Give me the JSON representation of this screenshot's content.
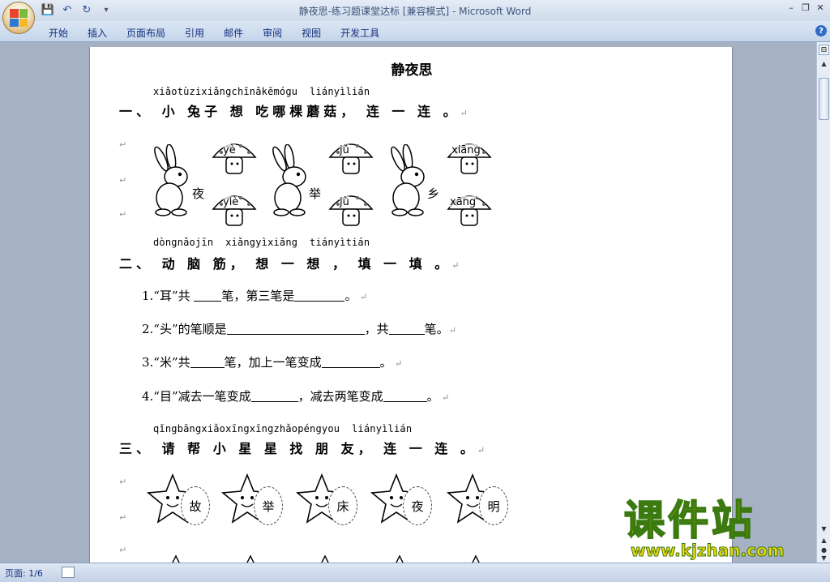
{
  "window": {
    "title": "静夜思-练习题课堂达标 [兼容模式] - Microsoft Word",
    "min": "–",
    "restore": "❐",
    "close": "✕"
  },
  "quick_access": {
    "save": "💾",
    "undo": "↶",
    "redo": "↻",
    "customize": "▾"
  },
  "ribbon": {
    "tabs": [
      "开始",
      "插入",
      "页面布局",
      "引用",
      "邮件",
      "审阅",
      "视图",
      "开发工具"
    ],
    "help": "?"
  },
  "document": {
    "title": "静夜思",
    "section1": {
      "pinyin": "xiǎotùzixiǎngchīnǎkēmógu  liányìlián",
      "heading": "一、 小 兔子 想  吃哪棵蘑菇，  连 一 连 。",
      "chars": [
        "夜",
        "举",
        "乡"
      ],
      "mushrooms_top": [
        "yè",
        "jǔ",
        "xiāng"
      ],
      "mushrooms_bottom": [
        "yiè",
        "jù",
        "xāng"
      ]
    },
    "section2": {
      "pinyin": "dòngnǎojīn  xiǎngyìxiǎng  tiányìtián",
      "heading": "二、 动 脑 筋，  想  一  想 ，  填 一 填 。",
      "questions": [
        {
          "pre": "1.“耳”共 ",
          "mid": "笔，第三笔是",
          "post": "。"
        },
        {
          "pre": "2.“头”的笔顺是",
          "mid": "，共",
          "post": "笔。"
        },
        {
          "pre": "3.“米”共",
          "mid": "笔，加上一笔变成",
          "post": "。"
        },
        {
          "pre": "4.“目”减去一笔变成",
          "mid": "，减去两笔变成",
          "post": "。"
        }
      ]
    },
    "section3": {
      "pinyin": "qǐngbāngxiǎoxīngxīngzhǎopéngyou  liányìlián",
      "heading": "三、 请  帮  小  星  星  找  朋  友， 连  一  连 。",
      "stars": [
        "故",
        "举",
        "床",
        "夜",
        "明"
      ]
    }
  },
  "status": {
    "page": "页面: 1/6"
  },
  "watermark": {
    "text": "课件站",
    "url": "www.kjzhan.com"
  },
  "colors": {
    "accent": "#15317e",
    "watermark_fill": "#f6df0a",
    "watermark_stroke": "#3a7a10"
  }
}
